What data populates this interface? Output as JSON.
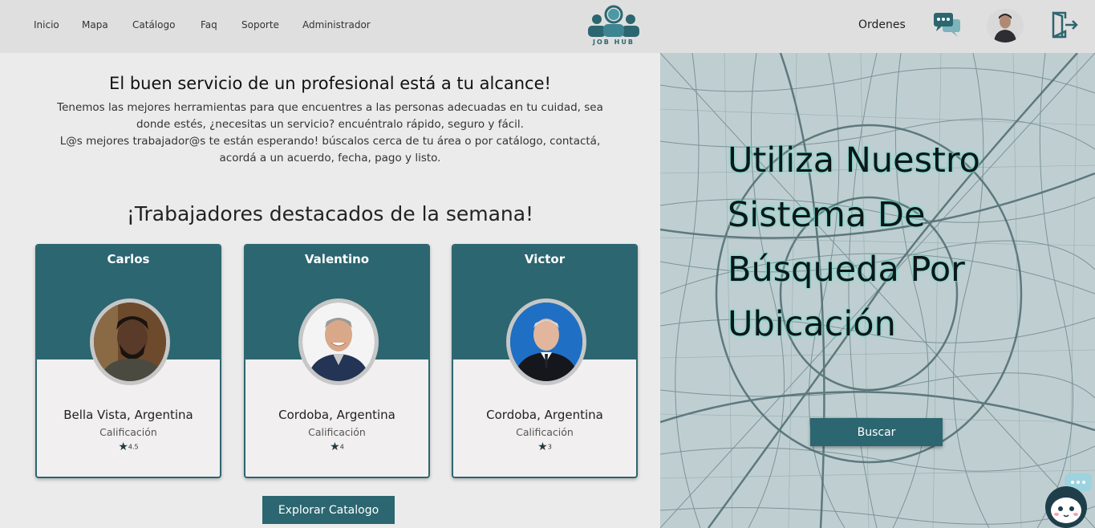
{
  "nav": {
    "items": [
      {
        "label": "Inicio"
      },
      {
        "label": "Mapa"
      },
      {
        "label": "Catálogo"
      },
      {
        "label": "Faq"
      },
      {
        "label": "Soporte"
      },
      {
        "label": "Administrador"
      }
    ],
    "logo_text": "JOB HUB",
    "orders_label": "Ordenes",
    "icons": {
      "chat": "chat-bubbles-icon",
      "logout": "logout-door-icon"
    }
  },
  "hero": {
    "title": "El buen servicio de un profesional está a tu alcance!",
    "line1": "Tenemos las mejores herramientas para que encuentres a las personas adecuadas en tu cuidad, sea",
    "line2": "donde estés, ¿necesitas un servicio? encuéntralo rápido, seguro y fácil.",
    "line3": "L@s mejores trabajador@s te están esperando! búscalos cerca de tu área o por catálogo, contactá,",
    "line4": "acordá a un acuerdo, fecha, pago y listo."
  },
  "featured": {
    "title": "¡Trabajadores destacados de la semana!",
    "workers": [
      {
        "name": "Carlos",
        "location": "Bella Vista, Argentina",
        "rating_label": "Calificación",
        "rating": "4.5"
      },
      {
        "name": "Valentino",
        "location": "Cordoba, Argentina",
        "rating_label": "Calificación",
        "rating": "4"
      },
      {
        "name": "Victor",
        "location": "Cordoba, Argentina",
        "rating_label": "Calificación",
        "rating": "3"
      }
    ],
    "explore_label": "Explorar Catalogo"
  },
  "map_panel": {
    "title_line1": "Utiliza Nuestro",
    "title_line2": "Sistema De",
    "title_line3": "Búsqueda Por",
    "title_line4": "Ubicación",
    "search_label": "Buscar"
  },
  "colors": {
    "accent": "#2c6670",
    "header_bg": "#e0dfdf",
    "map_bg": "#bfcfd1"
  }
}
